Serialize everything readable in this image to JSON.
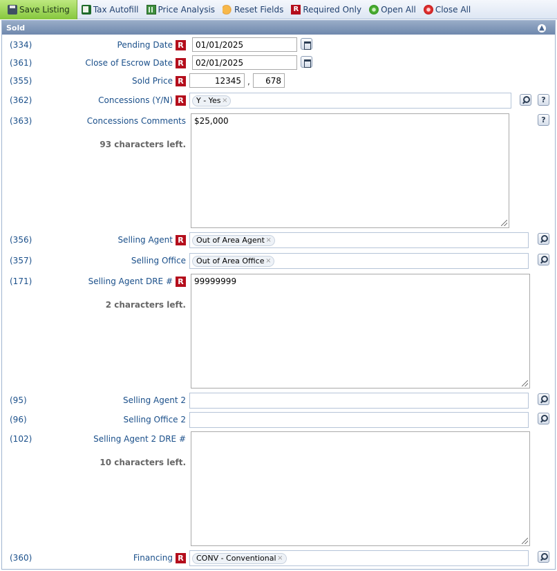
{
  "toolbar": {
    "save": "Save Listing",
    "tax": "Tax Autofill",
    "price": "Price Analysis",
    "reset": "Reset Fields",
    "required": "Required Only",
    "open": "Open All",
    "close": "Close All"
  },
  "section": {
    "title": "Sold"
  },
  "req_badge": "R",
  "fields": {
    "pending": {
      "num": "(334)",
      "label": "Pending Date",
      "value": "01/01/2025"
    },
    "close_escrow": {
      "num": "(361)",
      "label": "Close of Escrow Date",
      "value": "02/01/2025"
    },
    "sold_price": {
      "num": "(355)",
      "label": "Sold Price",
      "dollars": "12345",
      "sep": ",",
      "cents": "678"
    },
    "concessions": {
      "num": "(362)",
      "label": "Concessions (Y/N)",
      "chip": "Y - Yes"
    },
    "concessions_comments": {
      "num": "(363)",
      "label": "Concessions Comments",
      "value": "$25,000",
      "chars_left": "93 characters left."
    },
    "selling_agent": {
      "num": "(356)",
      "label": "Selling Agent",
      "chip": "Out of Area Agent"
    },
    "selling_office": {
      "num": "(357)",
      "label": "Selling Office",
      "chip": "Out of Area Office"
    },
    "selling_agent_dre": {
      "num": "(171)",
      "label": "Selling Agent DRE #",
      "value": "99999999",
      "chars_left": "2 characters left."
    },
    "selling_agent_2": {
      "num": "(95)",
      "label": "Selling Agent 2"
    },
    "selling_office_2": {
      "num": "(96)",
      "label": "Selling Office 2"
    },
    "selling_agent_2_dre": {
      "num": "(102)",
      "label": "Selling Agent 2 DRE #",
      "chars_left": "10 characters left."
    },
    "financing": {
      "num": "(360)",
      "label": "Financing",
      "chip": "CONV - Conventional"
    }
  },
  "chip_remove": "×",
  "help_symbol": "?"
}
